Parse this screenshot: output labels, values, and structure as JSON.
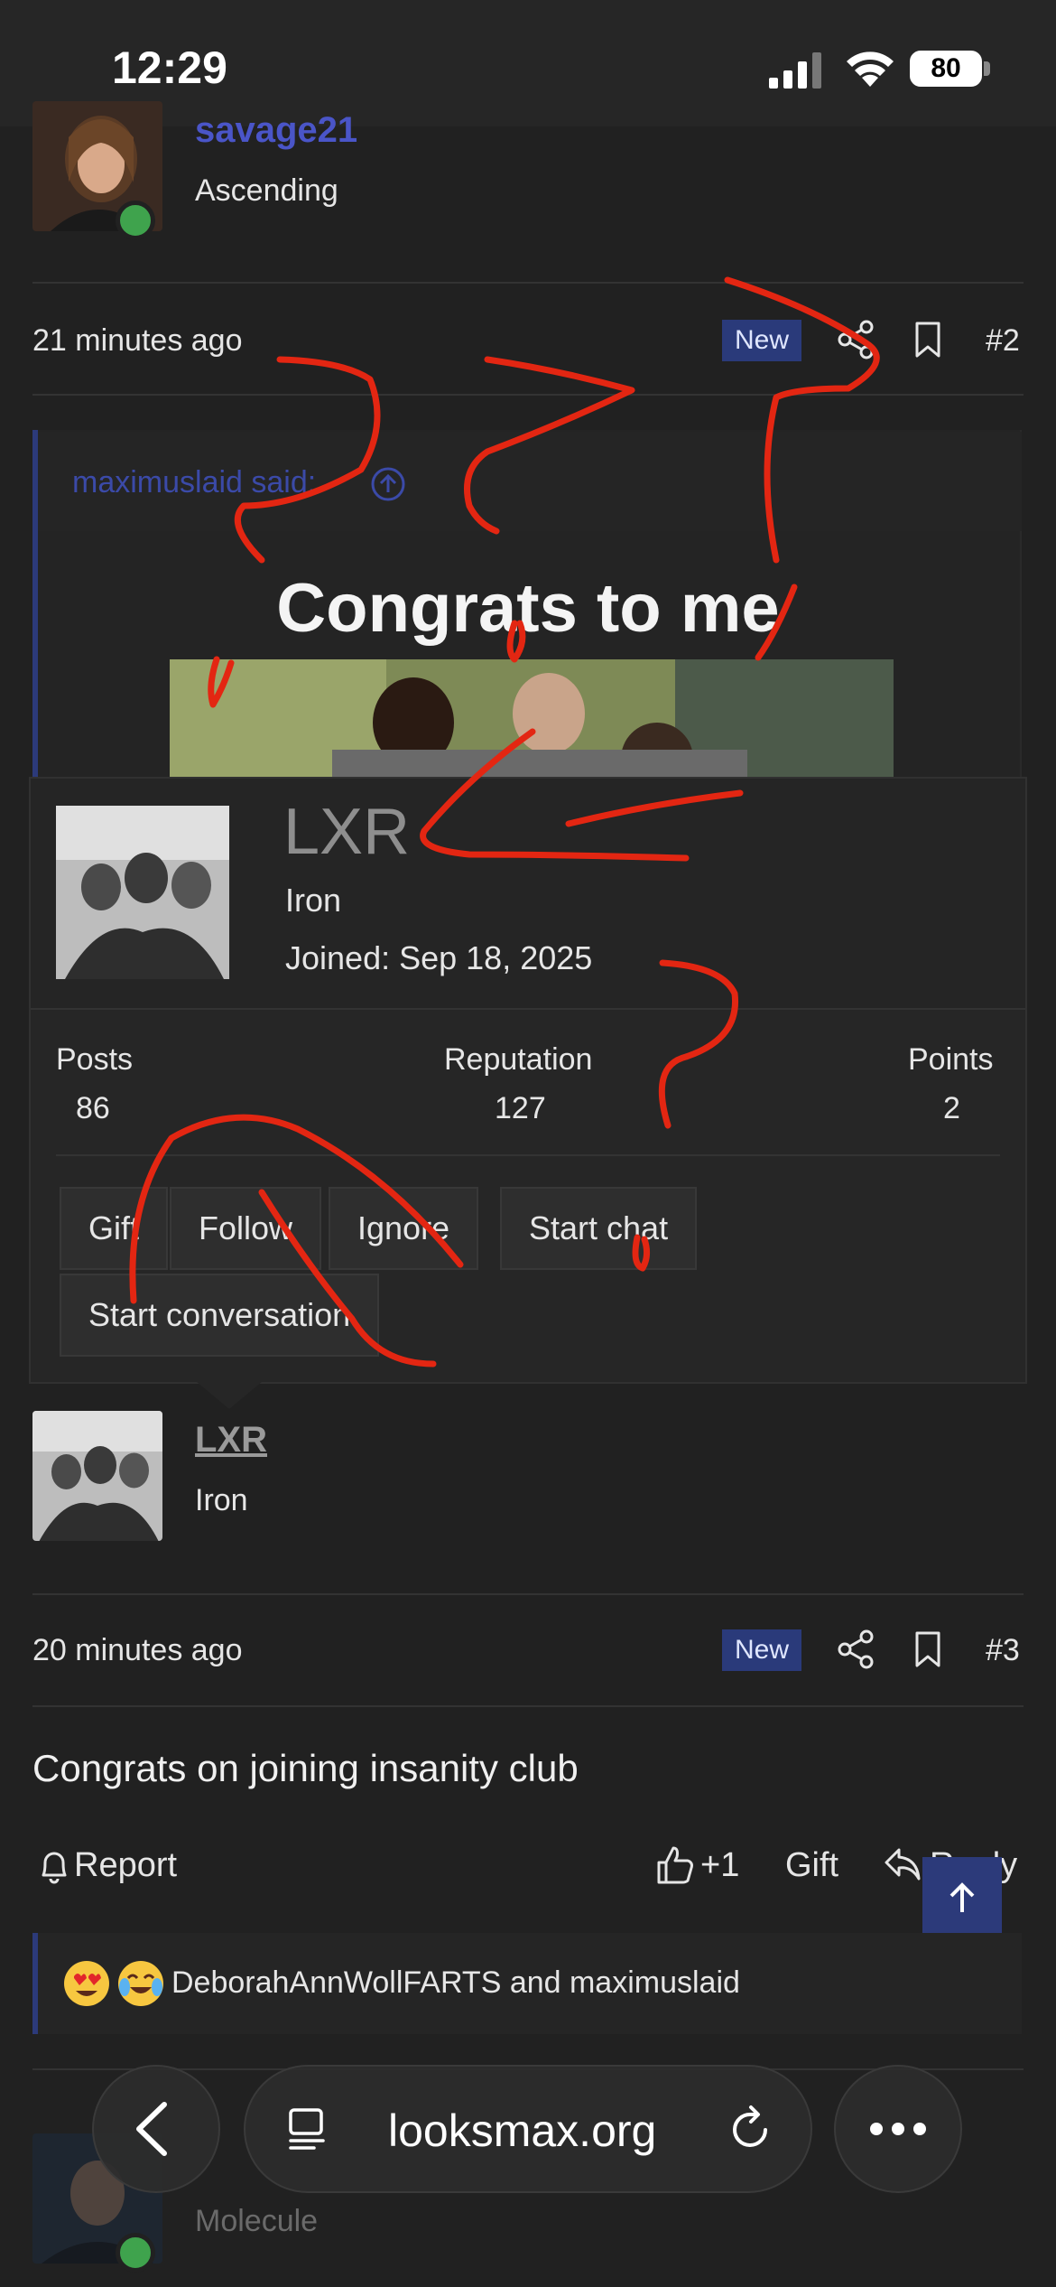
{
  "status_bar": {
    "time": "12:29",
    "battery": "80"
  },
  "post2": {
    "author": {
      "name": "savage21",
      "rank": "Ascending"
    },
    "time": "21 minutes ago",
    "badge": "New",
    "number": "#2",
    "quote": {
      "author_line": "maximuslaid said:",
      "title": "Congrats to me"
    }
  },
  "member_card": {
    "name": "LXR",
    "rank": "Iron",
    "joined": "Joined: Sep 18, 2025",
    "stats": [
      {
        "label": "Posts",
        "value": "86"
      },
      {
        "label": "Reputation",
        "value": "127"
      },
      {
        "label": "Points",
        "value": "2"
      }
    ],
    "buttons": [
      "Gift",
      "Follow",
      "Ignore",
      "Start chat",
      "Start conversation"
    ]
  },
  "post3": {
    "author": {
      "name": "LXR",
      "rank": "Iron"
    },
    "time": "20 minutes ago",
    "badge": "New",
    "number": "#3",
    "body": "Congrats on joining insanity club",
    "actions": {
      "report": "Report",
      "like": "+1",
      "gift": "Gift",
      "reply": "Reply"
    },
    "reactions": {
      "users": "DeborahAnnWollFARTS and maximuslaid",
      "emojis": [
        "heart-eyes",
        "crying-laughing"
      ]
    }
  },
  "next_post": {
    "author": {
      "rank": "Molecule"
    }
  },
  "browser": {
    "url": "looksmax.org"
  },
  "colors": {
    "accent_blue": "#2c3a7a",
    "annotation_red": "#e32612",
    "online_green": "#3fa34d"
  }
}
